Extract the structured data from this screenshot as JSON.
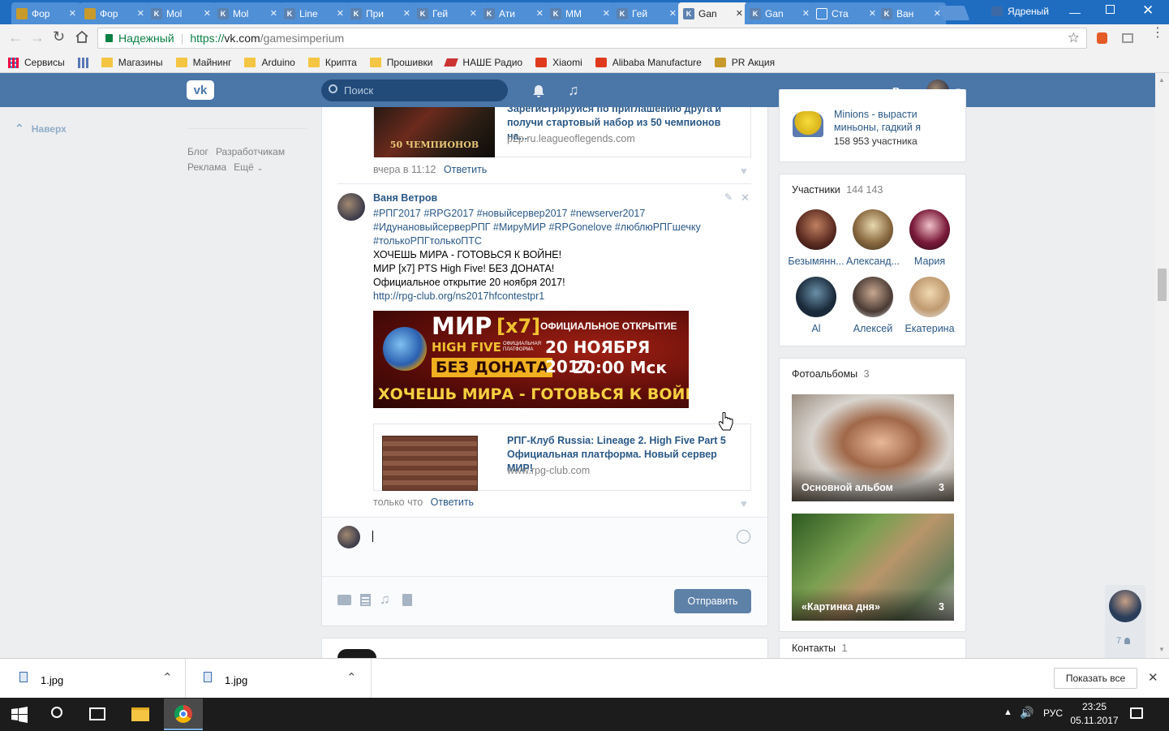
{
  "browser": {
    "tabs": [
      {
        "title": "Фор",
        "icon": "ru-crest-icon"
      },
      {
        "title": "Фор",
        "icon": "ru-crest-icon"
      },
      {
        "title": "Mol",
        "icon": "vk-icon"
      },
      {
        "title": "Mol",
        "icon": "vk-icon"
      },
      {
        "title": "Line",
        "icon": "vk-icon"
      },
      {
        "title": "При",
        "icon": "vk-icon"
      },
      {
        "title": "Гей",
        "icon": "vk-icon"
      },
      {
        "title": "Ати",
        "icon": "vk-icon"
      },
      {
        "title": "MM",
        "icon": "vk-icon"
      },
      {
        "title": "Гей",
        "icon": "vk-icon"
      },
      {
        "title": "Gan",
        "icon": "vk-icon",
        "active": true
      },
      {
        "title": "Gan",
        "icon": "vk-icon"
      },
      {
        "title": "Ста",
        "icon": "grid-icon"
      },
      {
        "title": "Ван",
        "icon": "vk-icon"
      }
    ],
    "profile_name": "Ядреный",
    "secure_label": "Надежный",
    "url_prefix": "https://",
    "url_host": "vk.com",
    "url_path": "/gamesimperium",
    "bookmarks": [
      "Сервисы",
      "Магазины",
      "Майнинг",
      "Arduino",
      "Крипта",
      "Прошивки",
      "НАШЕ Радио",
      "Xiaomi",
      "Alibaba Manufacture",
      "PR Акция"
    ]
  },
  "vk": {
    "search_placeholder": "Поиск",
    "user_name": "Ваня",
    "left": {
      "up_label": "Наверх",
      "footer": [
        "Блог",
        "Разработчикам",
        "Реклама",
        "Ещё"
      ]
    },
    "top_post": {
      "link_title": "Зарегистрируйся по приглашению друга и получи стартовый набор из 50 чемпионов на...",
      "link_domain": "p2p.ru.leagueoflegends.com",
      "thumb_text": "50 ЧЕМПИОНОВ",
      "time": "вчера в 11:12",
      "reply": "Ответить"
    },
    "comment": {
      "author": "Ваня Ветров",
      "hashtags": [
        "#РПГ2017 #RPG2017 #новыйсервер2017 #newserver2017",
        "#ИдунановыйсерверРПГ #МируМИР #RPGonelove #люблюРПГшечку",
        "#толькоРПГтолькоПТС"
      ],
      "lines": [
        "ХОЧЕШЬ МИРА - ГОТОВЬСЯ К ВОЙНЕ!",
        "МИР [x7] PTS High Five! БЕЗ ДОНАТА!",
        "Официальное открытие 20 ноября 2017!"
      ],
      "url": "http://rpg-club.org/ns2017hfcontestpr1",
      "banner": {
        "mir": "МИР",
        "x7": "[x7]",
        "high_five": "HIGH FIVE",
        "official_platform": "ОФИЦИАЛЬНАЯ ПЛАТФОРМА",
        "no_donate": "БЕЗ ДОНАТА",
        "open_title": "ОФИЦИАЛЬНОЕ ОТКРЫТИЕ",
        "date": "20 НОЯБРЯ 2017",
        "time": "20:00 Мск",
        "slogan": "ХОЧЕШЬ МИРА - ГОТОВЬСЯ К ВОЙНЕ"
      },
      "link_title": "РПГ-Клуб Russia: Lineage 2. High Five Part 5 Официальная платформа. Новый сервер МИР!",
      "link_domain": "www.rpg-club.com",
      "time": "только что",
      "reply": "Ответить"
    },
    "composer": {
      "send_label": "Отправить"
    },
    "right": {
      "group_name": "Minions - вырасти миньоны, гадкий я",
      "group_members": "158 953 участника",
      "members_title": "Участники",
      "members_count": "144 143",
      "members": [
        "Безымянн...",
        "Александ...",
        "Мария",
        "Al",
        "Алексей",
        "Екатерина"
      ],
      "albums_title": "Фотоальбомы",
      "albums_count": "3",
      "albums": [
        {
          "name": "Основной альбом",
          "count": "3"
        },
        {
          "name": "«Картинка дня»",
          "count": "3"
        }
      ],
      "contacts_title": "Контакты",
      "contacts_count": "1"
    },
    "chat_count": "7"
  },
  "downloads": {
    "files": [
      "1.jpg",
      "1.jpg"
    ],
    "show_all": "Показать все"
  },
  "taskbar": {
    "lang": "РУС",
    "time": "23:25",
    "date": "05.11.2017"
  },
  "colors": {
    "vk_blue": "#4a76a8",
    "chrome_tabbar": "#1f6dc1",
    "vk_link": "#2a5885"
  }
}
